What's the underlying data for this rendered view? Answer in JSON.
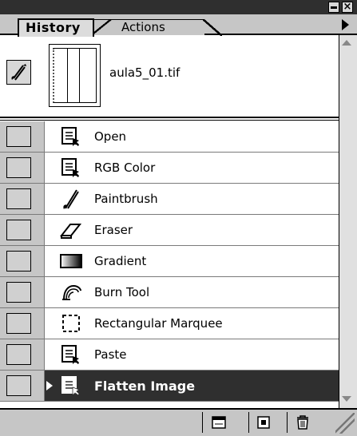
{
  "window": {
    "minimize_label": "",
    "close_label": "×"
  },
  "tabs": [
    {
      "label": "History",
      "active": true
    },
    {
      "label": "Actions",
      "active": false
    }
  ],
  "snapshot": {
    "label": "aula5_01.tif"
  },
  "history": [
    {
      "label": "Open",
      "icon": "document-icon"
    },
    {
      "label": "RGB Color",
      "icon": "document-icon"
    },
    {
      "label": "Paintbrush",
      "icon": "paintbrush-icon"
    },
    {
      "label": "Eraser",
      "icon": "eraser-icon"
    },
    {
      "label": "Gradient",
      "icon": "gradient-icon"
    },
    {
      "label": "Burn Tool",
      "icon": "burn-tool-icon"
    },
    {
      "label": "Rectangular Marquee",
      "icon": "marquee-icon"
    },
    {
      "label": "Paste",
      "icon": "document-icon"
    },
    {
      "label": "Flatten Image",
      "icon": "document-icon",
      "selected": true
    }
  ],
  "toolbar": {
    "buttons": [
      "new-document-from-state-icon",
      "new-snapshot-icon",
      "trash-icon"
    ]
  },
  "colors": {
    "selection": "#2f2f2f",
    "panel": "#c6c6c6",
    "titlebar": "#2f2f2f"
  }
}
